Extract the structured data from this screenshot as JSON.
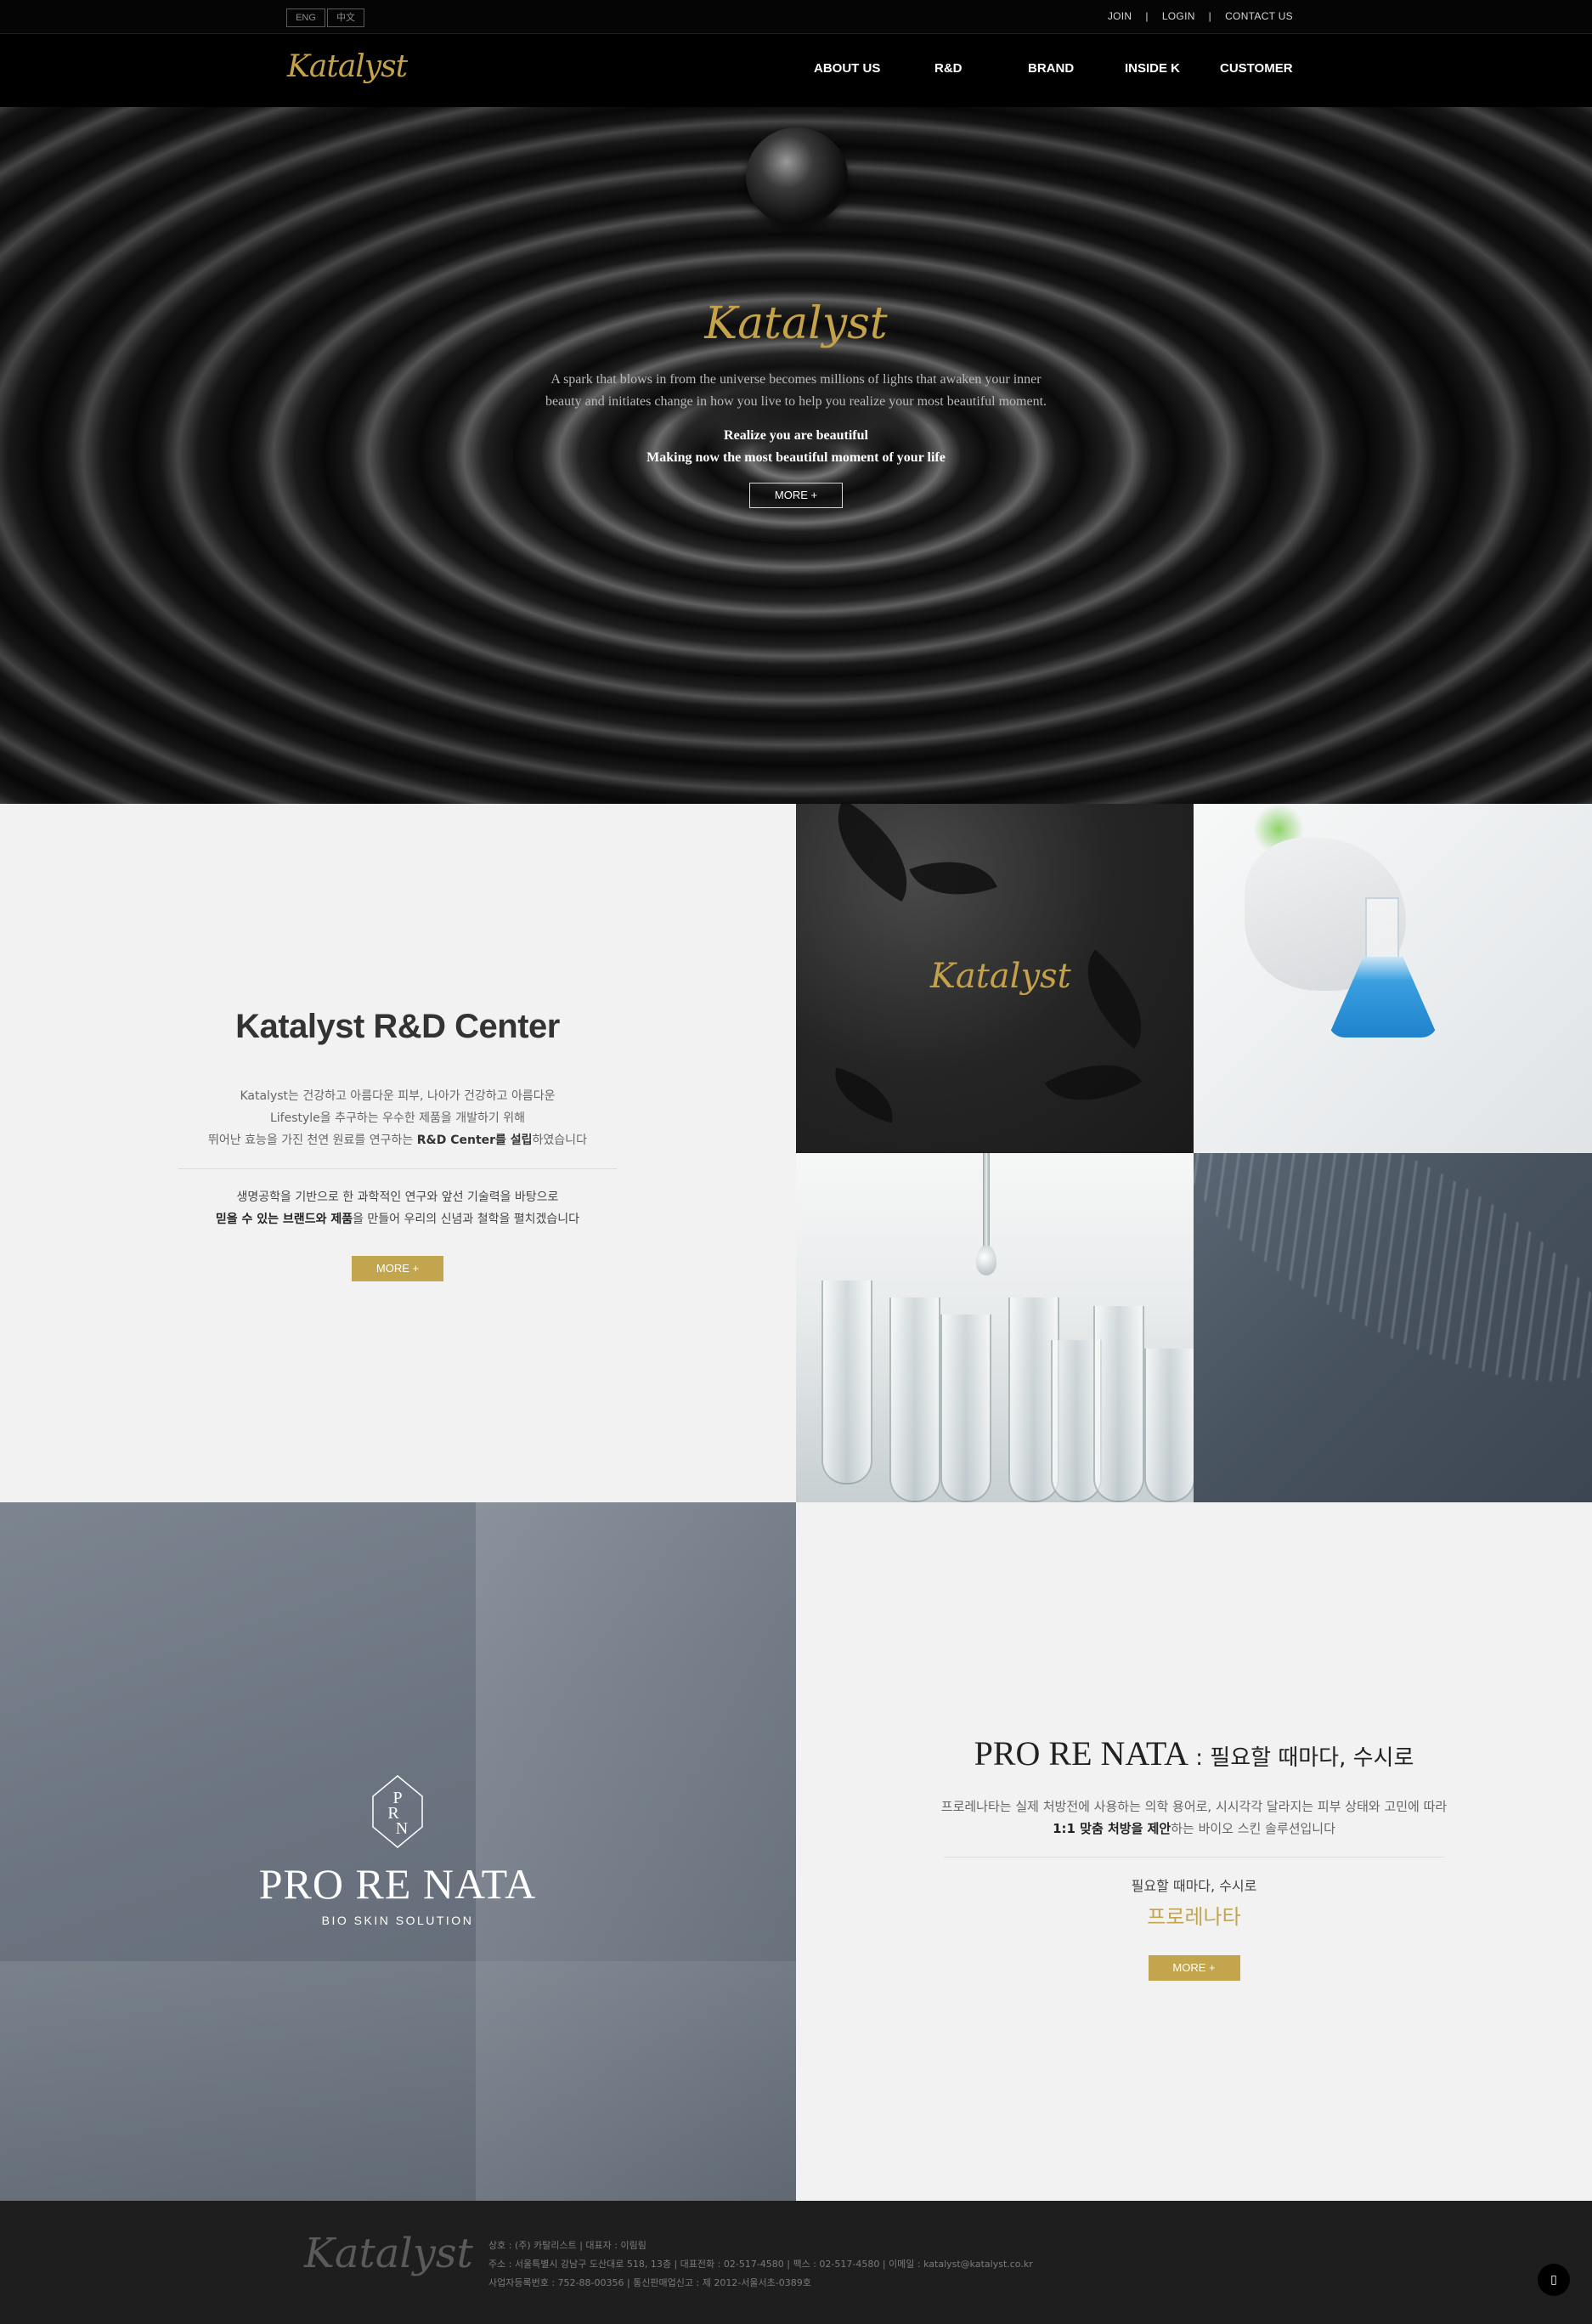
{
  "topbar": {
    "lang_eng": "ENG",
    "lang_cn": "中文",
    "links": [
      "JOIN",
      "LOGIN",
      "CONTACT US"
    ],
    "separator": "|"
  },
  "nav": {
    "logo": "Katalyst",
    "menu": [
      "ABOUT US",
      "R&D",
      "BRAND",
      "INSIDE K",
      "CUSTOMER"
    ]
  },
  "hero": {
    "logo": "Katalyst",
    "description": "A spark that blows in from the universe becomes millions of lights that awaken your inner beauty and initiates change in how you live to help you realize your most beautiful moment.",
    "emphasis_1": "Realize you are beautiful",
    "emphasis_2": "Making now the most beautiful moment of your life",
    "more_label": "MORE +"
  },
  "rd": {
    "title": "Katalyst R&D Center",
    "para1_line1": "Katalyst는 건강하고 아름다운 피부, 나아가 건강하고 아름다운",
    "para1_line2": "Lifestyle을 추구하는 우수한 제품을 개발하기 위해",
    "para1_line3_pre": "뛰어난 효능을 가진 천연 원료를 연구하는 ",
    "para1_line3_bold": "R&D Center를 설립",
    "para1_line3_post": "하였습니다",
    "para2_line1": "생명공학을 기반으로 한 과학적인 연구와 앞선 기술력을 바탕으로",
    "para2_line2_bold": "믿을 수 있는 브랜드와 제품",
    "para2_line2_post": "을 만들어 우리의 신념과 철학을 펼치겠습니다",
    "more_label": "MORE +",
    "tile_logo": "Katalyst"
  },
  "prn": {
    "emblem_letters": "PRN",
    "logo": "PRO RE NATA",
    "subtitle": "BIO SKIN SOLUTION",
    "title_en": "PRO RE NATA",
    "title_ko": " : 필요할 때마다, 수시로",
    "para_line1": "프로레나타는 실제 처방전에 사용하는 의학 용어로, 시시각각 달라지는 피부 상태와 고민에 따라",
    "para_line2_bold": "1:1 맞춤 처방을 제안",
    "para_line2_post": "하는 바이오 스킨 솔루션입니다",
    "tagline": "필요할 때마다, 수시로",
    "tagline_gold": "프로레나타",
    "more_label": "MORE +"
  },
  "footer": {
    "logo": "Katalyst",
    "line1": "상호 : (주) 카탈리스트   |   대표자 : 이림림",
    "line2": "주소 : 서울특별시 강남구 도산대로 518, 13층   |   대표전화 : 02-517-4580   |   팩스 : 02-517-4580   |   이메일 : katalyst@katalyst.co.kr",
    "line3": "사업자등록번호 : 752-88-00356   |   통신판매업신고 : 제 2012-서울서초-0389호",
    "top_button": "▯"
  },
  "colors": {
    "gold": "#c2a54c",
    "dark": "#000000",
    "light_bg": "#f2f2f2"
  }
}
